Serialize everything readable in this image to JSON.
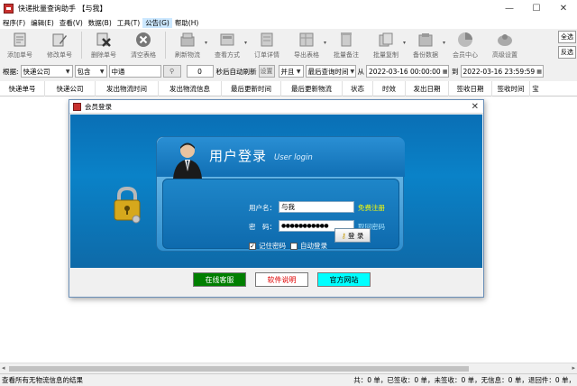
{
  "window": {
    "title": "快递批量查询助手 【与我】",
    "min": "—",
    "max": "☐",
    "close": "✕"
  },
  "menu": [
    "程序(F)",
    "编辑(E)",
    "查看(V)",
    "数据(B)",
    "工具(T)",
    "公告(G)",
    "帮助(H)"
  ],
  "toolbar": [
    {
      "label": "添加单号",
      "icon": "add-number-icon"
    },
    {
      "label": "修改单号",
      "icon": "edit-number-icon"
    },
    {
      "label": "删除单号",
      "icon": "delete-number-icon"
    },
    {
      "label": "清空表格",
      "icon": "clear-table-icon"
    },
    {
      "label": "刷新物流",
      "icon": "refresh-logistics-icon"
    },
    {
      "label": "查看方式",
      "icon": "view-mode-icon"
    },
    {
      "label": "订单详情",
      "icon": "order-detail-icon"
    },
    {
      "label": "导出表格",
      "icon": "export-table-icon"
    },
    {
      "label": "批量备注",
      "icon": "batch-remark-icon"
    },
    {
      "label": "批量复制",
      "icon": "batch-copy-icon"
    },
    {
      "label": "备份数据",
      "icon": "backup-data-icon"
    },
    {
      "label": "会员中心",
      "icon": "member-center-icon"
    },
    {
      "label": "高级设置",
      "icon": "advanced-settings-icon"
    }
  ],
  "right_buttons": [
    "全选",
    "反选"
  ],
  "filter": {
    "label": "根据:",
    "field": "快递公司",
    "op": "包含",
    "value": "中通",
    "refresh_seconds": "0",
    "auto_refresh_label": "秒后自动刷新",
    "set_label": "设置",
    "logic": "并且",
    "time_field": "最后查询时间",
    "from_label": "从",
    "from_date": "2022-03-16 00:00:00",
    "to_label": "到",
    "to_date": "2022-03-16 23:59:59"
  },
  "columns": [
    "快递单号",
    "快递公司",
    "发出物流时间",
    "发出物流信息",
    "最后更新时间",
    "最后更新物流",
    "状态",
    "时效",
    "发出日期",
    "签收日期",
    "签收时间",
    "宝"
  ],
  "status": {
    "left": "查看所有无物流信息的结果",
    "right": "共：0 单，已签收：0 单，未签收：0 单，无信息：0 单，退回件：0 单，"
  },
  "dialog": {
    "title": "会员登录",
    "close": "✕",
    "heading": "用户登录",
    "subheading": "User login",
    "username_label": "用户名：",
    "username_value": "与我",
    "password_label": "密　码：",
    "password_value": "●●●●●●●●●●●",
    "register_link": "免费注册",
    "retrieve_link": "取回密码",
    "remember_label": "记住密码",
    "autologin_label": "自动登录",
    "login_button": "登 录",
    "online_service": "在线客服",
    "software_help": "软件说明",
    "official_site": "官方网站"
  },
  "colors": {
    "dialog_blue": "#0a6fb5",
    "online_service_bg": "#007f00",
    "software_help_text": "#e00000",
    "official_site_bg": "#00ffff",
    "register_link": "#ffff00"
  }
}
